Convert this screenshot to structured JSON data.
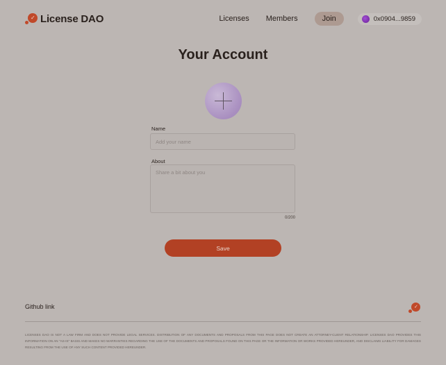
{
  "header": {
    "logo_text": "License DAO",
    "nav": [
      {
        "label": "Licenses"
      },
      {
        "label": "Members"
      }
    ],
    "join_label": "Join",
    "wallet_address": "0x0904...9859"
  },
  "page": {
    "title": "Your Account"
  },
  "form": {
    "name_label": "Name",
    "name_value": "",
    "name_placeholder": "Add your name",
    "about_label": "About",
    "about_value": "",
    "about_placeholder": "Share a bit about you",
    "about_counter": "0/200",
    "save_label": "Save"
  },
  "footer": {
    "github_label": "Github link",
    "disclaimer": "LICENSES DAO IS NOT A LAW FIRM AND DOES NOT PROVIDE LEGAL SERVICES. DISTRIBUTION OF ANY DOCUMENTS AND PROPOSALS FROM THIS PAGE DOES NOT CREATE AN ATTORNEY-CLIENT RELATIONSHIP. LICENSES DAO PROVIDES THIS INFORMATION ON AN \"AS-IS\" BASIS AND MAKES NO WARRANTIES REGARDING THE USE OF THE DOCUMENTS AND PROPOSALS FOUND ON THIS PAGE OR THE INFORMATION OR WORKS PROVIDED HEREUNDER, AND DISCLAIMS LIABILITY FOR DAMAGES RESULTING FROM THE USE OF ANY SUCH CONTENT PROVIDED HEREUNDER."
  },
  "colors": {
    "background": "#bcb6b3",
    "accent": "#b24124",
    "join_bg": "#ad9a91",
    "text": "#2a211d"
  },
  "icons": {
    "logo": "license-dao-logo-icon",
    "wallet_avatar": "wallet-avatar-icon",
    "upload": "plus-icon"
  }
}
